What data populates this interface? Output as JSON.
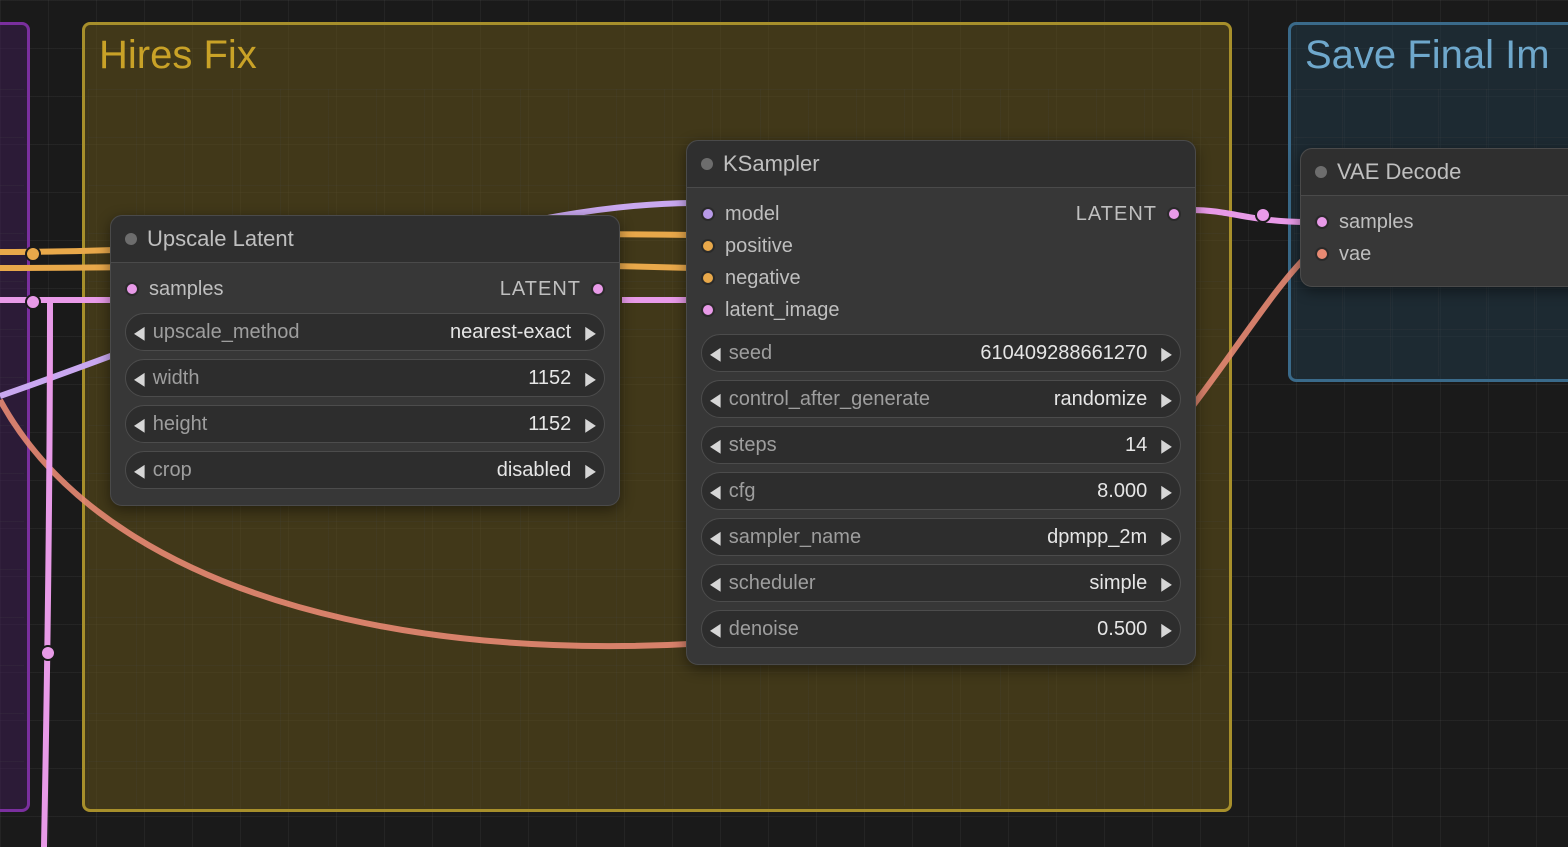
{
  "groups": {
    "hires": {
      "title": "Hires Fix"
    },
    "save": {
      "title": "Save Final Im"
    }
  },
  "nodes": {
    "upscale": {
      "title": "Upscale Latent",
      "inputs": [
        {
          "name": "samples",
          "type_tag": "LATENT"
        }
      ],
      "widgets": [
        {
          "name": "upscale_method",
          "value": "nearest-exact"
        },
        {
          "name": "width",
          "value": "1152"
        },
        {
          "name": "height",
          "value": "1152"
        },
        {
          "name": "crop",
          "value": "disabled"
        }
      ]
    },
    "ksampler": {
      "title": "KSampler",
      "inputs": [
        {
          "name": "model"
        },
        {
          "name": "positive"
        },
        {
          "name": "negative"
        },
        {
          "name": "latent_image"
        }
      ],
      "output_tag": "LATENT",
      "widgets": [
        {
          "name": "seed",
          "value": "610409288661270"
        },
        {
          "name": "control_after_generate",
          "value": "randomize"
        },
        {
          "name": "steps",
          "value": "14"
        },
        {
          "name": "cfg",
          "value": "8.000"
        },
        {
          "name": "sampler_name",
          "value": "dpmpp_2m"
        },
        {
          "name": "scheduler",
          "value": "simple"
        },
        {
          "name": "denoise",
          "value": "0.500"
        }
      ]
    },
    "vae": {
      "title": "VAE Decode",
      "inputs": [
        {
          "name": "samples"
        },
        {
          "name": "vae"
        }
      ]
    }
  }
}
